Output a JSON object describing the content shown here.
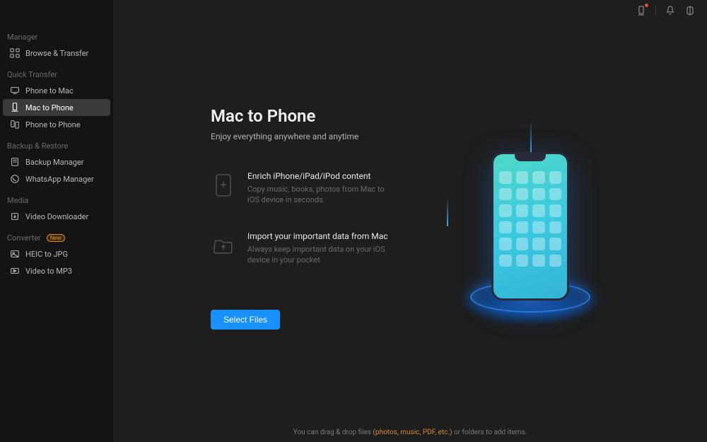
{
  "sidebar": {
    "sections": [
      {
        "header": "Manager",
        "items": [
          {
            "label": "Browse & Transfer",
            "icon": "grid"
          }
        ]
      },
      {
        "header": "Quick Transfer",
        "items": [
          {
            "label": "Phone to Mac",
            "icon": "phone-to-mac"
          },
          {
            "label": "Mac to Phone",
            "icon": "mac-to-phone",
            "active": true
          },
          {
            "label": "Phone to Phone",
            "icon": "phone-to-phone"
          }
        ]
      },
      {
        "header": "Backup & Restore",
        "items": [
          {
            "label": "Backup Manager",
            "icon": "backup"
          },
          {
            "label": "WhatsApp Manager",
            "icon": "whatsapp"
          }
        ]
      },
      {
        "header": "Media",
        "items": [
          {
            "label": "Video Downloader",
            "icon": "download"
          }
        ]
      },
      {
        "header": "Converter",
        "badge": "New",
        "items": [
          {
            "label": "HEIC to JPG",
            "icon": "image"
          },
          {
            "label": "Video to MP3",
            "icon": "video"
          }
        ]
      }
    ]
  },
  "page": {
    "title": "Mac to Phone",
    "subtitle": "Enjoy everything anywhere and anytime"
  },
  "features": [
    {
      "title": "Enrich iPhone/iPad/iPod content",
      "desc": "Copy music, books, photos from Mac to iOS device in seconds."
    },
    {
      "title": "Import your important data from Mac",
      "desc": "Always keep important data on your iOS device in your pocket"
    }
  ],
  "button": {
    "select_files": "Select Files"
  },
  "footer": {
    "pre": "You can drag & drop files ",
    "types": "(photos, music, PDF, etc.)",
    "post": " or folders to add items."
  }
}
